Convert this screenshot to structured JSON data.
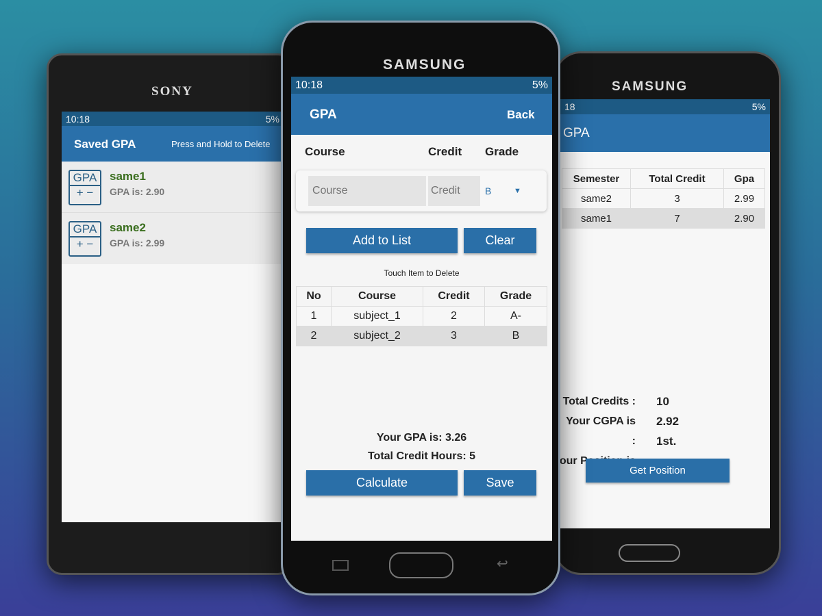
{
  "status": {
    "time": "10:18",
    "time_partial": "18",
    "battery": "5%"
  },
  "left_phone": {
    "brand": "SONY",
    "header_title": "Saved GPA",
    "header_hint": "Press and Hold to Delete",
    "items": [
      {
        "name": "same1",
        "gpa": "GPA is: 2.90",
        "icon_text": "GPA",
        "plus": "+",
        "minus": "−"
      },
      {
        "name": "same2",
        "gpa": "GPA is: 2.99",
        "icon_text": "GPA",
        "plus": "+",
        "minus": "−"
      }
    ]
  },
  "middle_phone": {
    "brand": "SAMSUNG",
    "header_title": "GPA",
    "back": "Back",
    "columns": {
      "course": "Course",
      "credit": "Credit",
      "grade": "Grade"
    },
    "course_placeholder": "Course",
    "credit_placeholder": "Credit",
    "grade_value": "B",
    "add_button": "Add to List",
    "clear_button": "Clear",
    "hint": "Touch Item to Delete",
    "table": {
      "headers": [
        "No",
        "Course",
        "Credit",
        "Grade"
      ],
      "rows": [
        [
          "1",
          "subject_1",
          "2",
          "A-"
        ],
        [
          "2",
          "subject_2",
          "3",
          "B"
        ]
      ]
    },
    "gpa_text": "Your GPA is: 3.26",
    "credit_text": "Total Credit Hours: 5",
    "calculate_button": "Calculate",
    "save_button": "Save"
  },
  "right_phone": {
    "brand": "SAMSUNG",
    "header_title": "GPA",
    "table": {
      "headers": [
        "Semester",
        "Total Credit",
        "Gpa"
      ],
      "rows": [
        [
          "same2",
          "3",
          "2.99"
        ],
        [
          "same1",
          "7",
          "2.90"
        ]
      ]
    },
    "total_credits_label": "Total Credits :",
    "total_credits": "10",
    "cgpa_label": "Your CGPA is :",
    "cgpa": "2.92",
    "position_label": "Your Position is :",
    "position": "1st.",
    "get_position_button": "Get Position"
  },
  "colors": {
    "primary": "#2a70aa",
    "status_bar": "#1d5a84",
    "item_title": "#3a6e1e"
  }
}
